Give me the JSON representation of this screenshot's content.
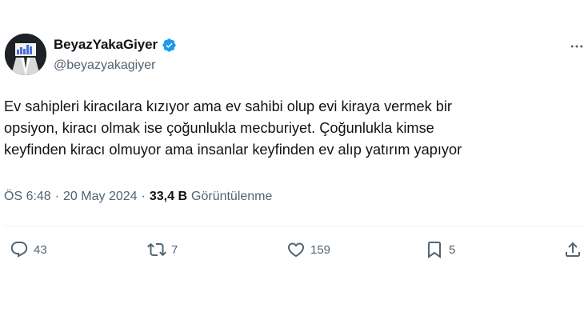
{
  "author": {
    "display_name": "BeyazYakaGiyer",
    "handle": "@beyazyakagiyer",
    "verified": true
  },
  "tweet": {
    "lines": [
      "Ev sahipleri kiracılara kızıyor ama ev sahibi olup evi kiraya vermek bir",
      "opsiyon, kiracı olmak ise çoğunlukla mecburiyet. Çoğunlukla kimse",
      "keyfinden kiracı olmuyor ama insanlar keyfinden ev alıp yatırım yapıyor"
    ]
  },
  "meta": {
    "time": "ÖS 6:48",
    "sep": "·",
    "date": "20 May 2024",
    "views": "33,4 B",
    "views_label": "Görüntülenme"
  },
  "actions": {
    "replies": "43",
    "retweets": "7",
    "likes": "159",
    "bookmarks": "5"
  },
  "colors": {
    "text": "#0f1419",
    "secondary": "#536471",
    "verified": "#1d9bf0",
    "divider": "#eff3f4"
  }
}
